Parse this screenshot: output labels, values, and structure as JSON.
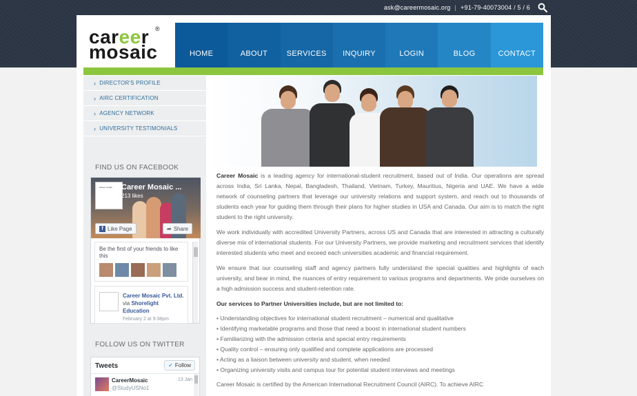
{
  "topbar": {
    "email": "ask@careermosaic.org",
    "separator": "|",
    "phone": "+91-79-40073004 / 5 / 6"
  },
  "logo": {
    "line1_prefix": "car",
    "line1_accent": "ee",
    "line1_suffix": "r",
    "line2": "mosaic",
    "registered": "®"
  },
  "nav": [
    {
      "label": "HOME",
      "color": "#0d5a9a"
    },
    {
      "label": "ABOUT",
      "color": "#11609f"
    },
    {
      "label": "SERVICES",
      "color": "#1567a6"
    },
    {
      "label": "INQUIRY",
      "color": "#1a6fae"
    },
    {
      "label": "LOGIN",
      "color": "#1f79b8"
    },
    {
      "label": "BLOG",
      "color": "#2586c6"
    },
    {
      "label": "CONTACT",
      "color": "#2b97d8"
    }
  ],
  "sidebar": {
    "menu": [
      {
        "label": "DIRECTOR'S PROFILE"
      },
      {
        "label": "AIRC CERTIFICATION"
      },
      {
        "label": "AGENCY NETWORK"
      },
      {
        "label": "UNIVERSITY TESTIMONIALS"
      }
    ],
    "facebook_heading": "FIND US ON FACEBOOK",
    "twitter_heading": "FOLLOW US ON TWITTER"
  },
  "facebook": {
    "thumb_text": "career mosaic",
    "page_name": "Career Mosaic ...",
    "likes": "213 likes",
    "like_button": "Like Page",
    "share_button": "Share",
    "friends_text": "Be the first of your friends to like this",
    "avatar_colors": [
      "#b98a6e",
      "#6e8aa8",
      "#9a6b55",
      "#c9a07b",
      "#7d8fa0"
    ],
    "post_title": "Career Mosaic Pvt. Ltd.",
    "post_via": "via",
    "post_source": "Shorelight Education",
    "post_date": "February 2 at 9:38pm"
  },
  "twitter": {
    "heading": "Tweets",
    "follow_button": "Follow",
    "tweet_name": "CareerMosaic",
    "tweet_handle": "@StudyUSNo1",
    "tweet_date": "13 Jan"
  },
  "content": {
    "p1_strong": "Career Mosaic",
    "p1_rest": " is a leading agency for international-student recruitment, based out of India. Our operations are spread across India, Sri Lanka, Nepal, Bangladesh, Thailand, Vietnam, Turkey, Mauritius, Nigeria and UAE. We have a wide network of counseling partners that leverage our university relations and support system, and reach out to thousands of students each year for guiding them through their plans for higher studies in USA and Canada. Our aim is to match the right student to the right university.",
    "p2": "We work individually with accredited University Partners, across US and Canada that are interested in attracting a culturally diverse mix of international students. For our University Partners, we provide marketing and recruitment services that identify interested students who meet and exceed each universities academic and financial requirement.",
    "p3": "We ensure that our counseling staff and agency partners fully understand the special qualities and highlights of each university, and bear in mind, the nuances of entry requirement to various programs and departments. We pride ourselves on a high admission success and student-retention rate.",
    "services_heading": "Our services to Partner Universities include, but are not limited to:",
    "services": [
      "• Understanding objectives for international student recruitment – numerical and qualitative",
      "• Identifying marketable programs and those that need a boost in international student numbers",
      "• Familiarizing with the admission criteria and special entry requirements",
      "• Quality control – ensuring only qualified and complete applications are processed",
      "• Acting as a liaison between university and student, when needed",
      "• Organizing university visits and campus tour for potential student interviews and meetings"
    ],
    "p4": "Career Mosaic is certified by the American International Recruitment Council (AIRC). To achieve AIRC"
  },
  "colors": {
    "accent_green": "#8cc63f",
    "link_blue": "#2f6c9a"
  }
}
